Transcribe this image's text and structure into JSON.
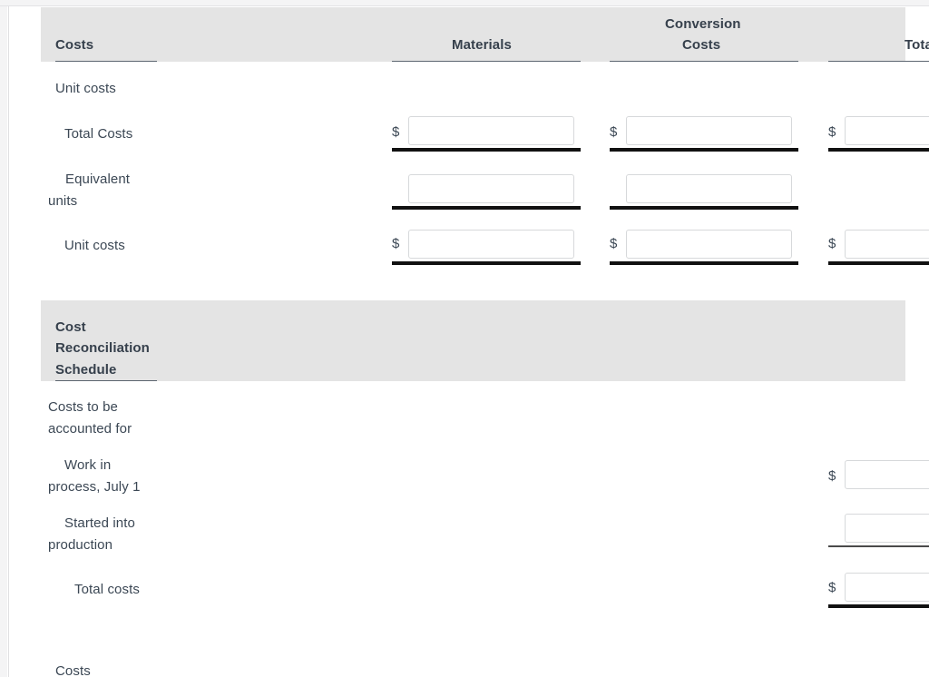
{
  "document": {
    "columns": [
      {
        "id": "label",
        "header": "Costs"
      },
      {
        "id": "materials",
        "header": "Materials"
      },
      {
        "id": "conversion",
        "header_line1": "Conversion",
        "header_line2": "Costs"
      },
      {
        "id": "total",
        "header": "Total"
      }
    ],
    "currency_symbol": "$",
    "sections": [
      {
        "id": "unit-costs",
        "title": "Unit costs",
        "rows": [
          {
            "id": "total-costs",
            "label": "Total Costs",
            "cells": [
              {
                "column": "materials",
                "currency": true,
                "value": "",
                "rule": "double"
              },
              {
                "column": "conversion",
                "currency": true,
                "value": "",
                "rule": "double"
              },
              {
                "column": "total",
                "currency": true,
                "value": "",
                "rule": "double"
              }
            ]
          },
          {
            "id": "equivalent-units",
            "label": "Equivalent units",
            "cells": [
              {
                "column": "materials",
                "currency": false,
                "value": "",
                "rule": "double"
              },
              {
                "column": "conversion",
                "currency": false,
                "value": "",
                "rule": "double"
              },
              {
                "column": "total",
                "currency": false,
                "value": null,
                "rule": "none"
              }
            ]
          },
          {
            "id": "unit-costs-row",
            "label": "Unit costs",
            "cells": [
              {
                "column": "materials",
                "currency": true,
                "value": "",
                "rule": "double"
              },
              {
                "column": "conversion",
                "currency": true,
                "value": "",
                "rule": "double"
              },
              {
                "column": "total",
                "currency": true,
                "value": "",
                "rule": "double"
              }
            ]
          }
        ]
      },
      {
        "id": "cost-reconciliation-schedule",
        "title_line1": "Cost",
        "title_line2": "Reconciliation",
        "title_line3": "Schedule",
        "subtitle": "Costs to be accounted for",
        "rows": [
          {
            "id": "wip-july-1",
            "label": "Work in process, July 1",
            "cells": [
              {
                "column": "total",
                "currency": true,
                "value": "",
                "rule": "none"
              }
            ]
          },
          {
            "id": "started-into-production",
            "label": "Started into production",
            "cells": [
              {
                "column": "total",
                "currency": false,
                "value": "",
                "rule": "single"
              }
            ]
          },
          {
            "id": "total-costs-recon",
            "label": "Total costs",
            "cells": [
              {
                "column": "total",
                "currency": true,
                "value": "",
                "rule": "double"
              }
            ]
          }
        ]
      },
      {
        "id": "costs-trailing",
        "title": "Costs",
        "rows": []
      }
    ]
  },
  "colors": {
    "band_background": "#e4e4e4",
    "text": "#3b4754",
    "heading_text": "#36404c",
    "rule": "#111111",
    "input_border": "#d7d9db",
    "page_background": "#ffffff",
    "chrome_background": "#f4f4f5"
  }
}
